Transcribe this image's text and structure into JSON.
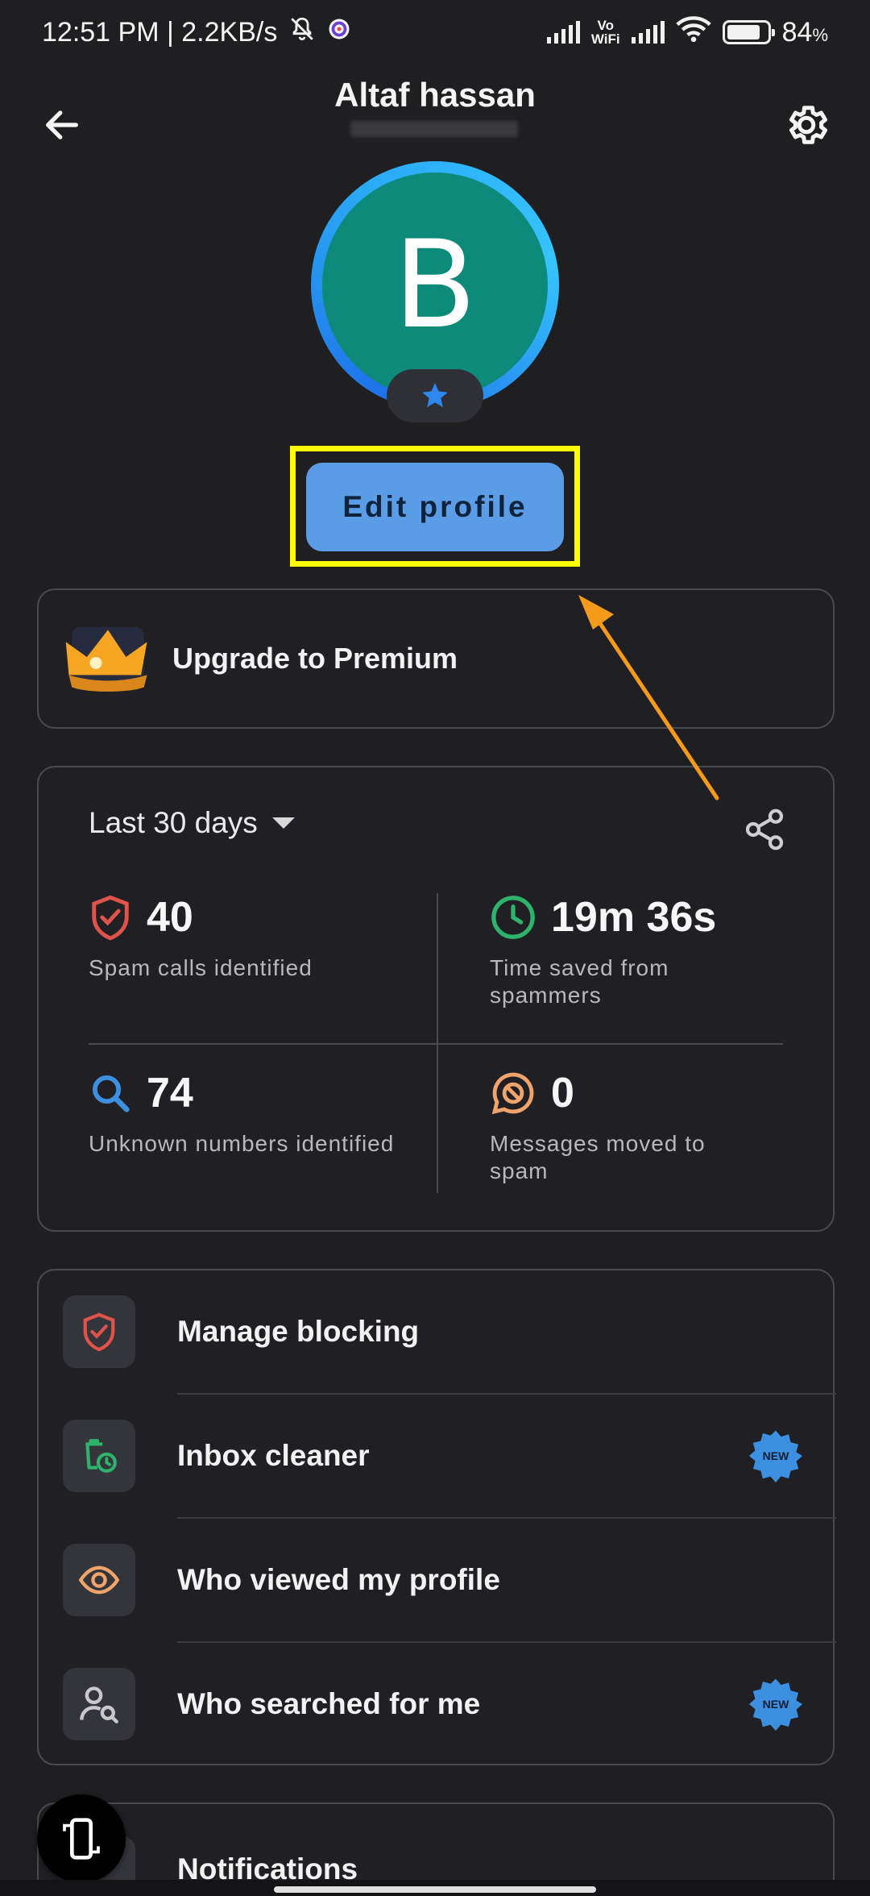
{
  "status_bar": {
    "time_speed": "12:51 PM | 2.2KB/s",
    "vowifi_top": "Vo",
    "vowifi_bottom": "WiFi",
    "battery": "84",
    "battery_unit": "%",
    "battery_level": 0.84
  },
  "header": {
    "name": "Altaf hassan",
    "back_icon": "arrow-left-icon",
    "settings_icon": "gear-icon"
  },
  "avatar": {
    "initial": "B",
    "badge_icon": "star-icon"
  },
  "edit_profile": {
    "label": "Edit profile"
  },
  "premium": {
    "label": "Upgrade to Premium",
    "icon": "crown-icon"
  },
  "stats": {
    "period": "Last 30 days",
    "share_icon": "share-icon",
    "items": [
      {
        "value": "40",
        "label": "Spam calls identified",
        "icon": "shield-check-icon",
        "color": "#e0534a"
      },
      {
        "value": "19m 36s",
        "label": "Time saved from spammers",
        "icon": "clock-icon",
        "color": "#2db36a"
      },
      {
        "value": "74",
        "label": "Unknown numbers identified",
        "icon": "search-icon",
        "color": "#3d8fe0"
      },
      {
        "value": "0",
        "label": "Messages moved to spam",
        "icon": "blocked-message-icon",
        "color": "#f0a36a"
      }
    ]
  },
  "menu": {
    "items": [
      {
        "label": "Manage blocking",
        "icon": "shield-check-icon",
        "new": false
      },
      {
        "label": "Inbox cleaner",
        "icon": "trash-clock-icon",
        "new": true
      },
      {
        "label": "Who viewed my profile",
        "icon": "eye-icon",
        "new": false
      },
      {
        "label": "Who searched for me",
        "icon": "user-search-icon",
        "new": true
      }
    ],
    "new_badge": "NEW"
  },
  "notifications": {
    "label": "Notifications"
  },
  "colors": {
    "background": "#1f1f22",
    "accent": "#5b9ce6",
    "highlight": "#ffff00",
    "annotation_arrow": "#f59a1b",
    "avatar": "#0e8a7a"
  }
}
